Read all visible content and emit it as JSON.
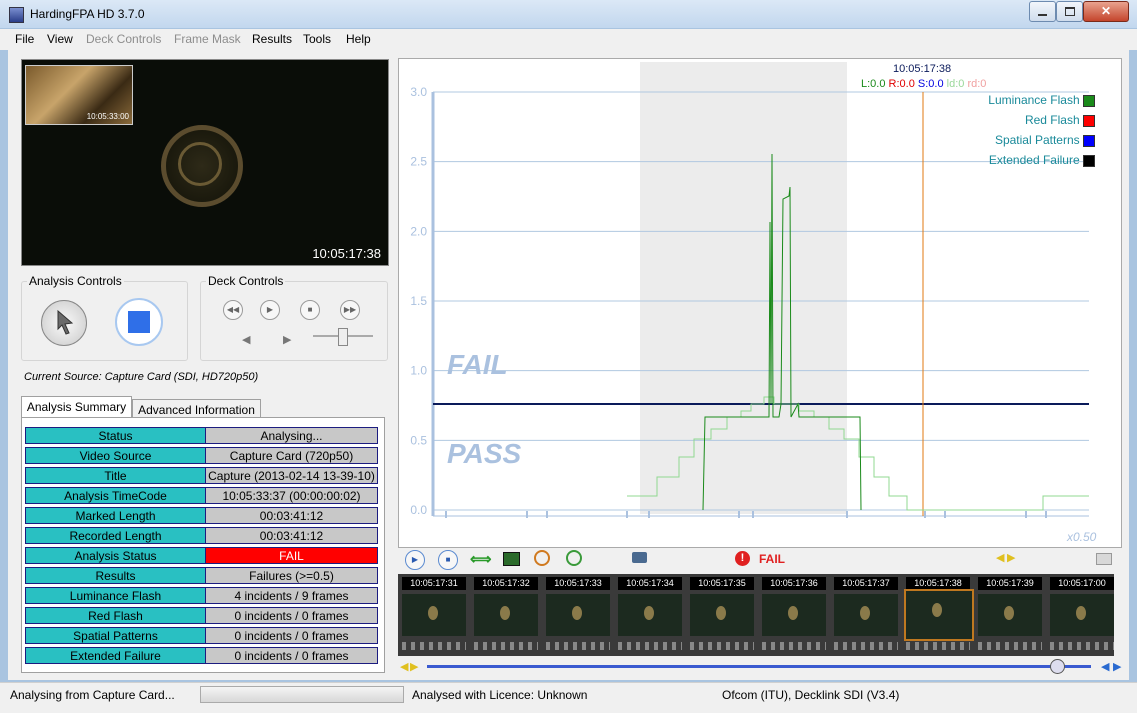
{
  "window": {
    "title": "HardingFPA HD 3.7.0"
  },
  "menu": [
    {
      "label": "File",
      "enabled": true
    },
    {
      "label": "View",
      "enabled": true
    },
    {
      "label": "Deck Controls",
      "enabled": false
    },
    {
      "label": "Frame Mask",
      "enabled": false
    },
    {
      "label": "Results",
      "enabled": true
    },
    {
      "label": "Tools",
      "enabled": true
    },
    {
      "label": "Help",
      "enabled": true
    }
  ],
  "video": {
    "thumb_timecode": "10:05:33:00",
    "timecode": "10:05:17:38"
  },
  "analysis_controls": {
    "label": "Analysis Controls"
  },
  "deck_controls": {
    "label": "Deck Controls"
  },
  "current_source": "Current Source: Capture Card (SDI, HD720p50)",
  "tabs": {
    "summary": "Analysis Summary",
    "advanced": "Advanced Information"
  },
  "summary_rows": [
    {
      "label": "Status",
      "value": "Analysing..."
    },
    {
      "label": "Video Source",
      "value": "Capture Card (720p50)"
    },
    {
      "label": "Title",
      "value": "Capture (2013-02-14 13-39-10)"
    },
    {
      "label": "Analysis TimeCode",
      "value": "10:05:33:37 (00:00:00:02)"
    },
    {
      "label": "Marked Length",
      "value": "00:03:41:12"
    },
    {
      "label": "Recorded Length",
      "value": "00:03:41:12"
    },
    {
      "label": "Analysis Status",
      "value": "FAIL",
      "status": "fail"
    },
    {
      "label": "Results",
      "value": "Failures (>=0.5)"
    },
    {
      "label": "Luminance Flash",
      "value": "4 incidents / 9 frames"
    },
    {
      "label": "Red Flash",
      "value": "0 incidents / 0 frames"
    },
    {
      "label": "Spatial Patterns",
      "value": "0 incidents / 0 frames"
    },
    {
      "label": "Extended Failure",
      "value": "0 incidents / 0 frames"
    }
  ],
  "graph": {
    "cursor_timecode": "10:05:17:38",
    "readout": {
      "L": "L:0.0",
      "R": "R:0.0",
      "S": "S:0.0",
      "ld": "ld:0",
      "rd": "rd:0"
    },
    "y_ticks": [
      "3.0",
      "2.5",
      "2.0",
      "1.5",
      "1.0",
      "0.5",
      "0.0"
    ],
    "fail_label": "FAIL",
    "pass_label": "PASS",
    "zoom_label": "x0.50",
    "legend": [
      {
        "label": "Luminance Flash",
        "color": "#1a8a1a"
      },
      {
        "label": "Red Flash",
        "color": "#ff0000"
      },
      {
        "label": "Spatial Patterns",
        "color": "#0000ff"
      },
      {
        "label": "Extended Failure",
        "color": "#000000"
      }
    ],
    "colors": {
      "threshold": "#0a1a5a",
      "luminance": "#1a8a1a",
      "luminance_light": "#90d890",
      "cursor": "#e07a10",
      "highlight": "#ececec"
    }
  },
  "toolbar": {
    "fail_text": "FAIL"
  },
  "filmstrip": [
    "10:05:17:31",
    "10:05:17:32",
    "10:05:17:33",
    "10:05:17:34",
    "10:05:17:35",
    "10:05:17:36",
    "10:05:17:37",
    "10:05:17:38",
    "10:05:17:39",
    "10:05:17:00"
  ],
  "filmstrip_selected_index": 7,
  "status": {
    "left": "Analysing from Capture Card...",
    "licence": "Analysed with Licence: Unknown",
    "device": "Ofcom (ITU), Decklink SDI (V3.4)"
  }
}
